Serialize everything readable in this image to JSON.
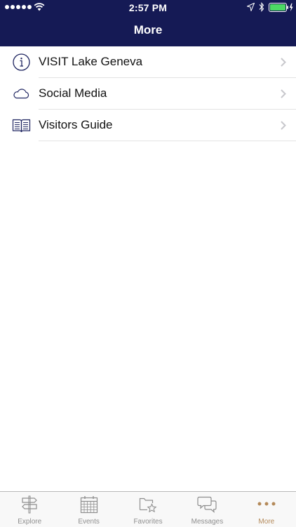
{
  "status_bar": {
    "time": "2:57 PM"
  },
  "nav": {
    "title": "More"
  },
  "colors": {
    "header_bg": "#151a55",
    "icon_color": "#1e2460",
    "active_tab": "#b48a5a",
    "inactive_tab": "#8e8e8e"
  },
  "list": {
    "items": [
      {
        "label": "VISIT Lake Geneva",
        "icon": "info-icon"
      },
      {
        "label": "Social Media",
        "icon": "cloud-icon"
      },
      {
        "label": "Visitors Guide",
        "icon": "book-icon"
      }
    ]
  },
  "tabs": [
    {
      "label": "Explore",
      "icon": "signpost-icon",
      "active": false
    },
    {
      "label": "Events",
      "icon": "calendar-icon",
      "active": false
    },
    {
      "label": "Favorites",
      "icon": "folder-star-icon",
      "active": false
    },
    {
      "label": "Messages",
      "icon": "chat-bubbles-icon",
      "active": false
    },
    {
      "label": "More",
      "icon": "more-dots-icon",
      "active": true
    }
  ]
}
